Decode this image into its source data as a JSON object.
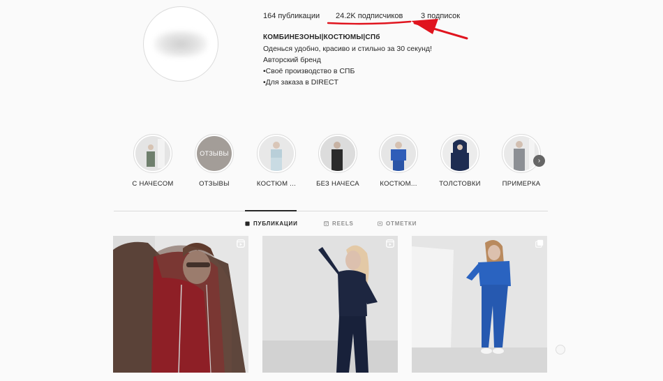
{
  "profile": {
    "stats": {
      "posts": "164 публикации",
      "followers": "24.2K подписчиков",
      "following": "3 подписок"
    },
    "bio": {
      "name": "КОМБИНЕЗОНЫ|КОСТЮМЫ|СПб",
      "lines": [
        "Оденься удобно, красиво и стильно за 30 секунд!",
        "Авторский бренд",
        "•Своё производство в СПБ",
        "•Для заказа в DIRECT"
      ]
    }
  },
  "highlights": [
    {
      "label": "С НАЧЕСОМ",
      "thumb_color": "#8a9a8a",
      "icon": "person-photo"
    },
    {
      "label": "ОТЗЫВЫ",
      "thumb_color": "#a39d98",
      "thumb_text": "ОТЗЫВЫ"
    },
    {
      "label": "КОСТЮМ ...",
      "thumb_color": "#b9cfd9",
      "icon": "person-photo"
    },
    {
      "label": "БЕЗ НАЧЕСА",
      "thumb_color": "#2b2b2b",
      "icon": "person-photo"
    },
    {
      "label": "КОСТЮМ...",
      "thumb_color": "#2f5db8",
      "icon": "person-photo"
    },
    {
      "label": "ТОЛСТОВКИ",
      "thumb_color": "#1e2d52",
      "icon": "person-photo"
    },
    {
      "label": "ПРИМЕРКА",
      "thumb_color": "#8c8f94",
      "icon": "person-photo"
    }
  ],
  "highlights_next_icon": "chevron-right-icon",
  "tabs": [
    {
      "label": "ПУБЛИКАЦИИ",
      "icon": "grid-icon",
      "active": true
    },
    {
      "label": "REELS",
      "icon": "reels-icon",
      "active": false
    },
    {
      "label": "ОТМЕТКИ",
      "icon": "tagged-icon",
      "active": false
    }
  ],
  "posts": [
    {
      "type": "reel",
      "description": "woman in brown jacket and red hoodie",
      "badge_icon": "reels-icon"
    },
    {
      "type": "reel",
      "description": "woman in navy tracksuit",
      "badge_icon": "reels-icon"
    },
    {
      "type": "carousel",
      "description": "woman in blue tracksuit",
      "badge_icon": "carousel-icon"
    }
  ],
  "colors": {
    "background": "#fafafa",
    "annotation": "#e0141e",
    "text": "#262626",
    "muted": "#8e8e8e",
    "border": "#dbdbdb"
  }
}
